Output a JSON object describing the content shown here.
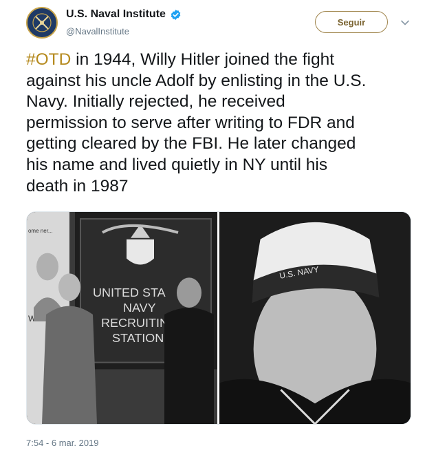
{
  "header": {
    "display_name": "U.S. Naval Institute",
    "handle": "@NavalInstitute",
    "follow_label": "Seguir"
  },
  "tweet": {
    "hashtag": "#OTD",
    "text": " in 1944, Willy Hitler joined the fight\nagainst his uncle Adolf by enlisting in the U.S.\nNavy. Initially rejected, he received\npermission to serve after writing to FDR and\ngetting cleared by the FBI. He later changed\nhis name and lived quietly in NY until his\ndeath in 1987",
    "timestamp": "7:54 - 6 mar. 2019"
  },
  "media": {
    "left_photo": {
      "poster_text": "ome\nner...",
      "poster_fragment": "WA",
      "sign_line1": "UNITED STA",
      "sign_line2": "NAVY",
      "sign_line3": "RECRUITIN",
      "sign_line4": "STATION"
    },
    "right_photo": {
      "cap_text": "U.S. NAVY"
    }
  },
  "colors": {
    "accent_gold": "#b58a1e",
    "verified_blue": "#1da1f2",
    "muted": "#657786"
  },
  "icons": {
    "verified": "verified-badge-icon",
    "chevron": "chevron-down-icon",
    "avatar": "naval-institute-seal"
  }
}
